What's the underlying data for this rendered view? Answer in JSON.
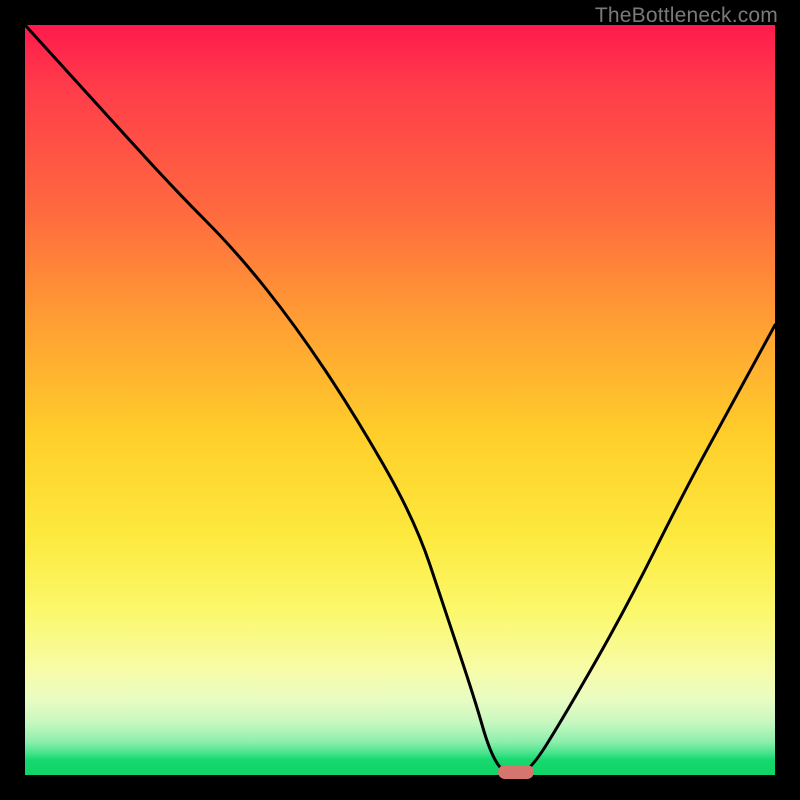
{
  "watermark": "TheBottleneck.com",
  "chart_data": {
    "type": "line",
    "title": "",
    "xlabel": "",
    "ylabel": "",
    "xlim": [
      0,
      100
    ],
    "ylim": [
      0,
      100
    ],
    "grid": false,
    "legend": false,
    "background": "red-yellow-green vertical gradient (bottleneck heatmap)",
    "series": [
      {
        "name": "bottleneck-curve",
        "x": [
          0,
          10,
          20,
          28,
          36,
          44,
          52,
          56,
          60,
          62,
          64,
          67,
          72,
          80,
          88,
          94,
          100
        ],
        "values": [
          100,
          89,
          78,
          70,
          60,
          48,
          34,
          22,
          10,
          3,
          0,
          0,
          8,
          22,
          38,
          49,
          60
        ]
      }
    ],
    "marker": {
      "x": 65.5,
      "y": 0,
      "color": "#d4766d",
      "shape": "pill"
    },
    "note": "Values are estimated from pixel positions; y=0 is the green floor, y=100 is the top."
  },
  "colors": {
    "frame": "#000000",
    "curve": "#000000",
    "marker": "#d4766d",
    "watermark": "#7a7a7a"
  }
}
